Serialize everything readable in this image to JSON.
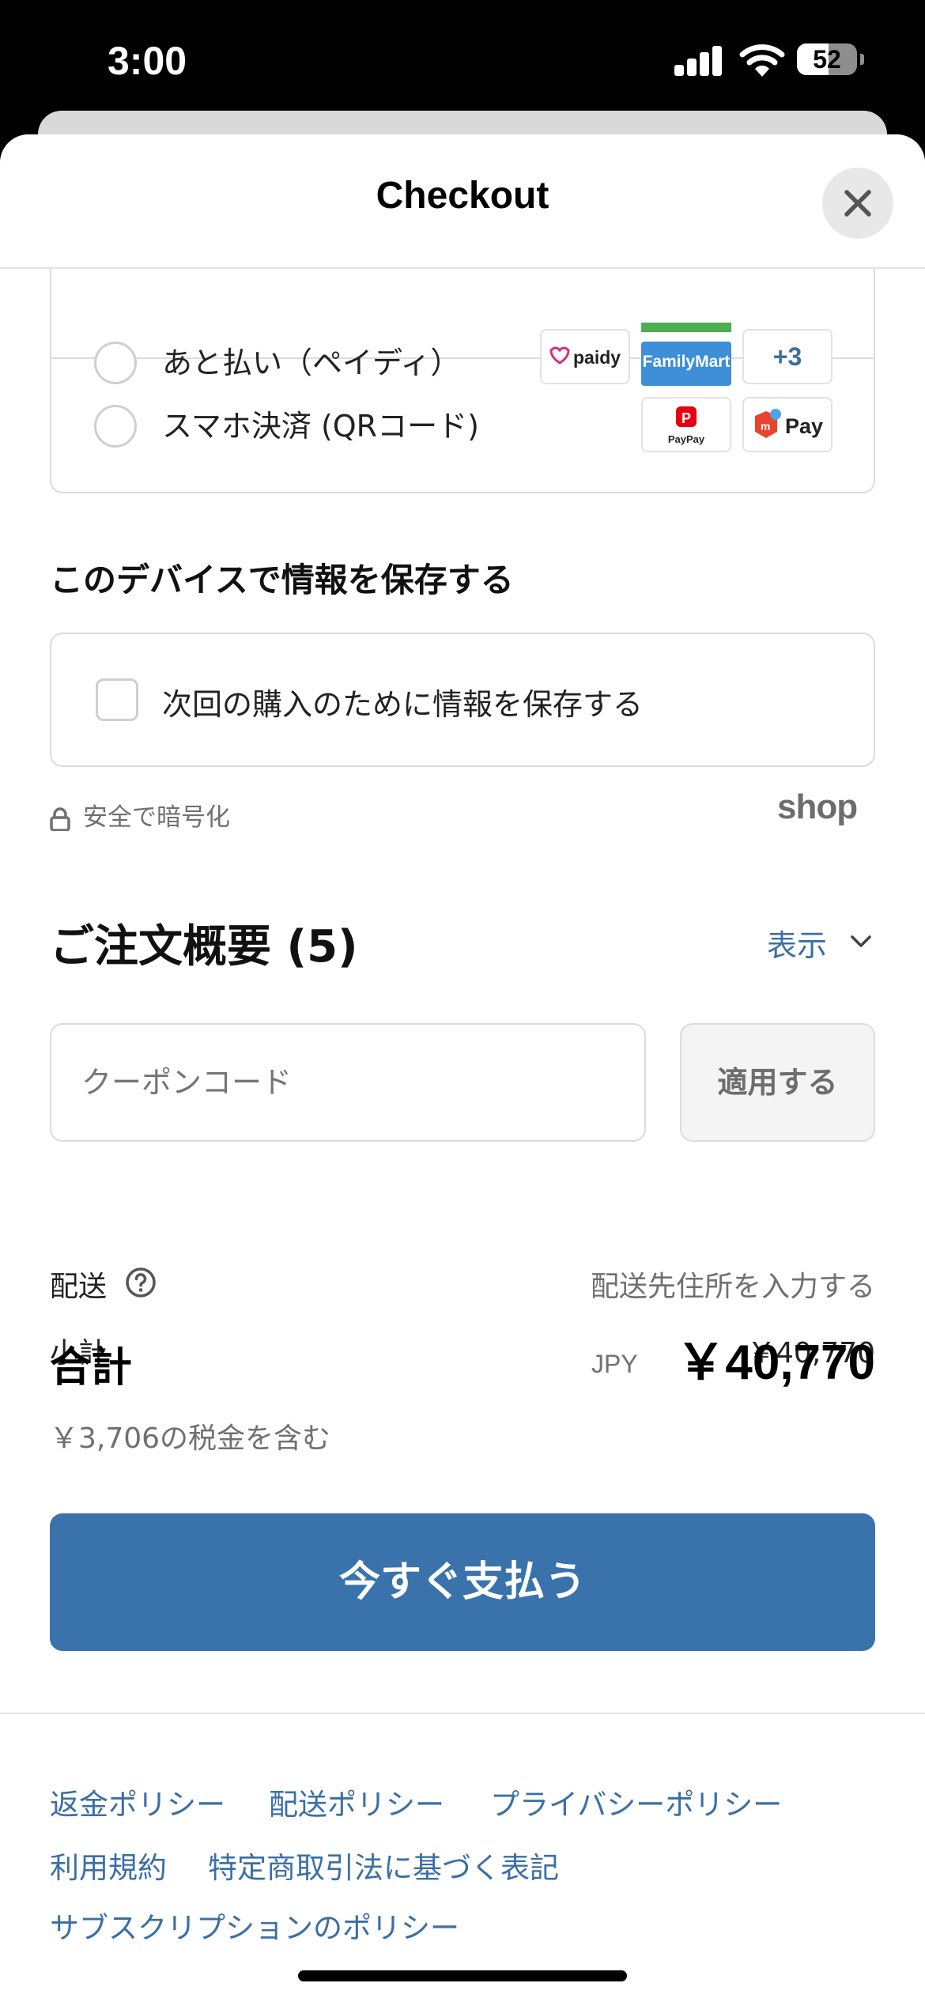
{
  "status_bar": {
    "time": "3:00",
    "battery": "52",
    "battery_level": 0.52
  },
  "header": {
    "title": "Checkout"
  },
  "payment_methods": [
    {
      "label": "あと払い（ペイディ）",
      "logos": [
        "paidy",
        "FamilyMart",
        "+3"
      ]
    },
    {
      "label": "スマホ決済 (QRコード)",
      "logos": [
        "PayPay",
        "Pay"
      ]
    }
  ],
  "save_section": {
    "title": "このデバイスで情報を保存する",
    "checkbox_label": "次回の購入のために情報を保存する",
    "secure_text": "安全で暗号化",
    "shop_logo": "shop"
  },
  "summary": {
    "title": "ご注文概要 (5)",
    "toggle_label": "表示",
    "coupon_placeholder": "クーポンコード",
    "apply_label": "適用する",
    "subtotal_label": "小計",
    "subtotal_value": "￥40,770",
    "shipping_label": "配送",
    "shipping_value": "配送先住所を入力する",
    "total_label": "合計",
    "currency": "JPY",
    "total_value": "￥40,770",
    "tax_note": "￥3,706の税金を含む"
  },
  "pay_button": {
    "label": "今すぐ支払う"
  },
  "policies": [
    "返金ポリシー",
    "配送ポリシー",
    "プライバシーポリシー",
    "利用規約",
    "特定商取引法に基づく表記",
    "サブスクリプションのポリシー"
  ],
  "colors": {
    "accent": "#3a72ab",
    "link": "#3b6fa5",
    "border": "#dcdcdc"
  }
}
